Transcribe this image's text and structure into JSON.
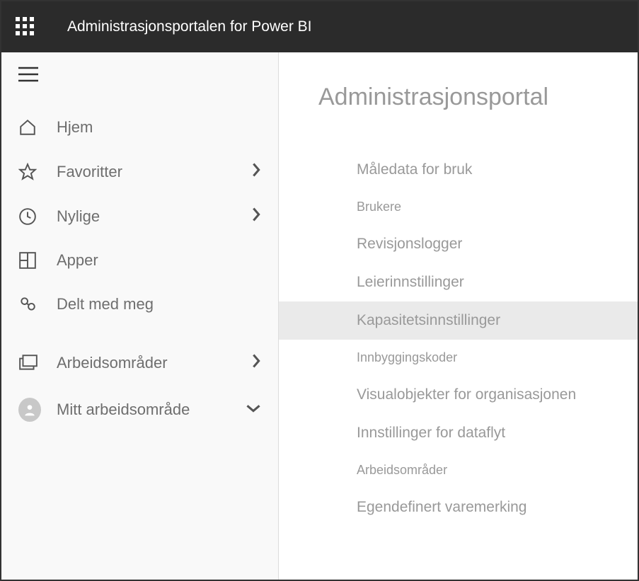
{
  "header": {
    "title": "Administrasjonsportalen for Power BI"
  },
  "sidebar": {
    "items": [
      {
        "icon": "home-icon",
        "label": "Hjem",
        "chevron": ""
      },
      {
        "icon": "star-icon",
        "label": "Favoritter",
        "chevron": "right"
      },
      {
        "icon": "clock-icon",
        "label": "Nylige",
        "chevron": "right"
      },
      {
        "icon": "apps-icon",
        "label": "Apper",
        "chevron": ""
      },
      {
        "icon": "share-icon",
        "label": "Delt med meg",
        "chevron": ""
      },
      {
        "icon": "workspaces-icon",
        "label": "Arbeidsområder",
        "chevron": "right"
      },
      {
        "icon": "avatar-icon",
        "label": "Mitt arbeidsområde",
        "chevron": "down"
      }
    ]
  },
  "main": {
    "title": "Administrasjonsportal",
    "menu": [
      {
        "label": "Måledata for bruk",
        "selected": false,
        "small": false
      },
      {
        "label": "Brukere",
        "selected": false,
        "small": true
      },
      {
        "label": "Revisjonslogger",
        "selected": false,
        "small": false
      },
      {
        "label": "Leierinnstillinger",
        "selected": false,
        "small": false
      },
      {
        "label": "Kapasitetsinnstillinger",
        "selected": true,
        "small": false
      },
      {
        "label": "Innbyggingskoder",
        "selected": false,
        "small": true
      },
      {
        "label": "Visualobjekter for organisasjonen",
        "selected": false,
        "small": false
      },
      {
        "label": "Innstillinger for dataflyt",
        "selected": false,
        "small": false
      },
      {
        "label": "Arbeidsområder",
        "selected": false,
        "small": true
      },
      {
        "label": "Egendefinert varemerking",
        "selected": false,
        "small": false
      }
    ]
  }
}
